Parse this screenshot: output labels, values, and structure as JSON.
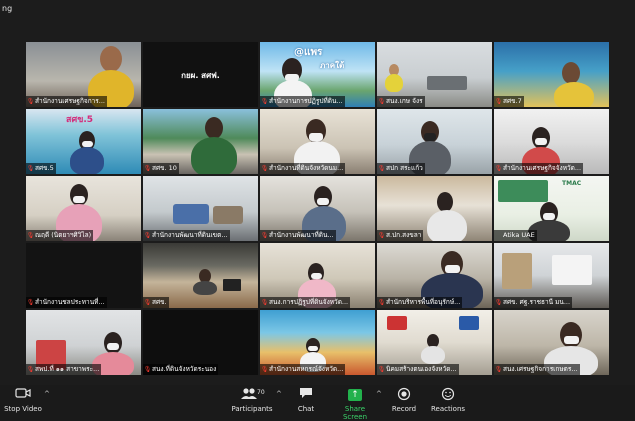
{
  "window": {
    "title_fragment": "ng"
  },
  "tiles": [
    {
      "name": "สำนักงานเศรษฐกิจการ...",
      "muted": true
    },
    {
      "name": "",
      "muted": false,
      "center_text": "กยผ. สศฟ."
    },
    {
      "name": "สำนักงานการปฏิรูปที่ดิน...",
      "muted": true,
      "logo": "@แพร",
      "logo2": "ภาคใต้"
    },
    {
      "name": "สนง.เกษ จังร",
      "muted": true
    },
    {
      "name": "สศข.7",
      "muted": true
    },
    {
      "name": "สศข.5",
      "muted": true,
      "logo": "สศข.5"
    },
    {
      "name": "สศข. 10",
      "muted": true
    },
    {
      "name": "สำนักงานที่ดินจังหวัดนม...",
      "muted": true
    },
    {
      "name": "สปก สระแก้ว",
      "muted": true
    },
    {
      "name": "สำนักงานเศรษฐกิจจังหวัด...",
      "muted": true
    },
    {
      "name": "ณฤดี (นิตยาฯศิวิไล)",
      "muted": true
    },
    {
      "name": "สำนักงานพัฒนาที่ดินเขต...",
      "muted": true
    },
    {
      "name": "สำนักงานพัฒนาที่ดิน...",
      "muted": true
    },
    {
      "name": "ส.ปก.สงขลา",
      "muted": true
    },
    {
      "name": "Atika UAE",
      "muted": false,
      "active": true,
      "logo": "TMAC"
    },
    {
      "name": "สำนักงานชลประทานที่...",
      "muted": true
    },
    {
      "name": "สศข.",
      "muted": true
    },
    {
      "name": "สนง.การปฏิรูปที่ดินจังหวัด...",
      "muted": true
    },
    {
      "name": "สำนักบริหารพื้นที่อนุรักษ์...",
      "muted": true
    },
    {
      "name": "สศข. ศฐ.ราชธานี มน...",
      "muted": true
    },
    {
      "name": "สพป.ที่ ๑๑ สาขาพระ...",
      "muted": true
    },
    {
      "name": "สนง.ที่ดินจังหวัดระนอง",
      "muted": true
    },
    {
      "name": "สำนักงานสหกรณ์จังหวัด...",
      "muted": true
    },
    {
      "name": "นิคมสร้างตนเองจังหวัด...",
      "muted": true
    },
    {
      "name": "สนง.เศรษฐกิจการเกษตร...",
      "muted": true
    }
  ],
  "toolbar": {
    "stop_video": "Stop Video",
    "participants": "Participants",
    "participants_count": "70",
    "chat": "Chat",
    "share_screen": "Share Screen",
    "record": "Record",
    "reactions": "Reactions"
  },
  "colors": {
    "active_border": "#3bd43b",
    "share_green": "#22b14c",
    "muted_red": "#ff3b30"
  }
}
